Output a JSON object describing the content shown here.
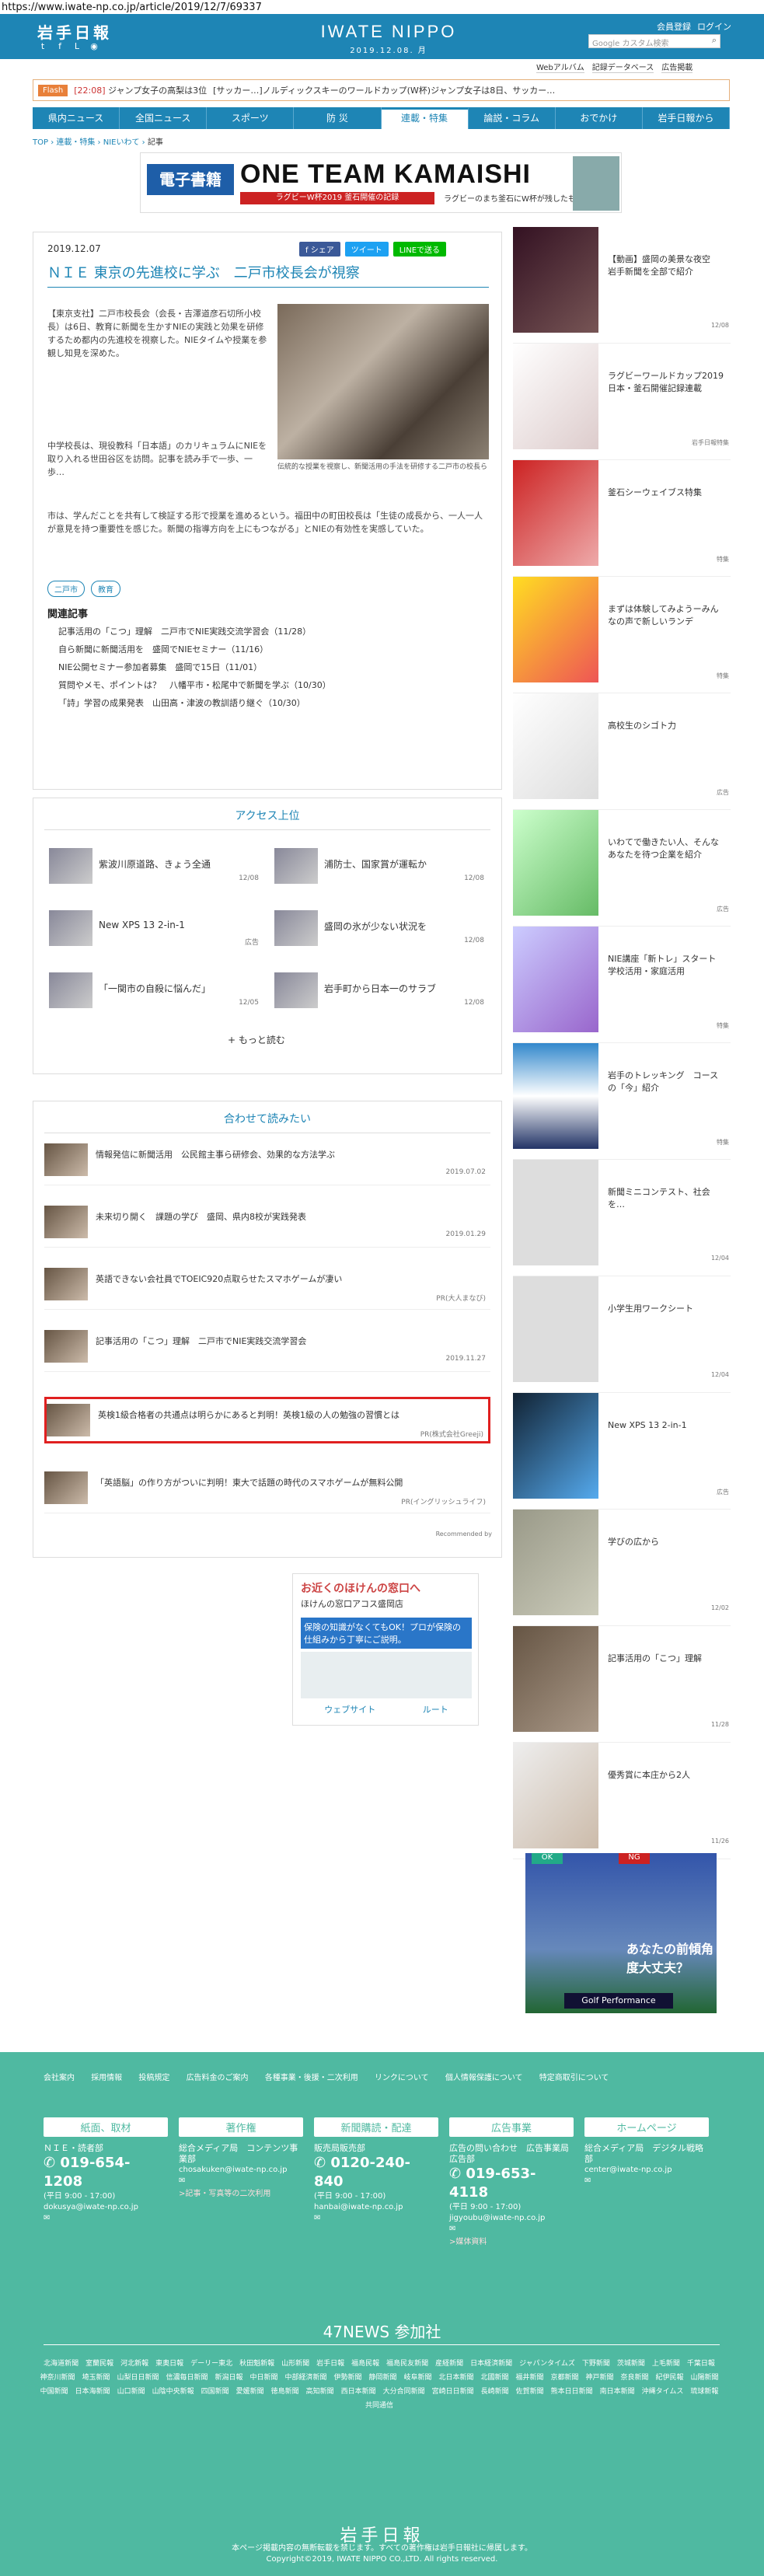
{
  "url": "https://www.iwate-np.co.jp/article/2019/12/7/69337",
  "header": {
    "logo": "岩手日報",
    "site_title": "IWATE NIPPO",
    "site_date": "2019.12.08. 月",
    "links": [
      "会員登録",
      "ログイン"
    ],
    "search_placeholder": "Google カスタム検索",
    "sub_links": [
      "Webアルバム",
      "記録データベース",
      "広告掲載"
    ]
  },
  "flash": {
    "label": "Flash",
    "items": [
      {
        "time": "[22:08]",
        "text": "ジャンプ女子の高梨は3位"
      },
      {
        "time": "",
        "text": "[サッカー…]ノルディックスキーのワールドカップ(W杯)ジャンプ女子は8日、サッカー…"
      }
    ]
  },
  "nav": [
    "県内ニュース",
    "全国ニュース",
    "スポーツ",
    "防 災",
    "連載・特集",
    "論説・コラム",
    "おでかけ",
    "岩手日報から"
  ],
  "breadcrumb": [
    "TOP",
    "連載・特集",
    "NIEいわて"
  ],
  "breadcrumb_current": "記事",
  "banner": {
    "b1": "電子書籍",
    "b2": "ONE TEAM KAMAISHI",
    "b3": "ラグビーW杯2019 釜石開催の記録",
    "b4": "ラグビーのまち釜石にW杯が残したものとは…"
  },
  "article": {
    "date": "2019.12.07",
    "share": [
      "f シェア",
      "ツイート",
      "LINEで送る"
    ],
    "headline": "ＮＩＥ 東京の先進校に学ぶ　二戸市校長会が視察",
    "caption": "伝統的な授業を視察し、新聞活用の手法を研修する二戸市の校長ら",
    "body1": "【東京支社】二戸市校長会（会長・吉澤道彦石切所小校長）は6日、教育に新聞を生かすNIEの実践と効果を研修するため都内の先進校を視察した。NIEタイムや授業を参観し知見を深めた。",
    "body2": "中学校長は、現役教科「日本語」のカリキュラムにNIEを取り入れる世田谷区を訪問。記事を読み手で一歩、一歩…",
    "body3": "市は、学んだことを共有して検証する形で授業を進めるという。福田中の町田校長は「生徒の成長から、一人一人が意見を持つ重要性を感じた。新聞の指導方向を上にもつながる」とNIEの有効性を実感していた。",
    "tags": [
      "二戸市",
      "教育"
    ],
    "related_title": "関連記事",
    "related": [
      "記事活用の「こつ」理解　二戸市でNIE実践交流学習会（11/28）",
      "自ら新聞に新聞活用を　盛岡でNIEセミナー（11/16）",
      "NIE公開セミナー参加者募集　盛岡で15日（11/01）",
      "質問やメモ、ポイントは？　八幡平市・松尾中で新聞を学ぶ（10/30）",
      "「詩」学習の成果発表　山田高・津波の教訓語り継ぐ（10/30）"
    ]
  },
  "ranking": {
    "title": "アクセス上位",
    "items": [
      {
        "text": "紫波川原道路、きょう全通",
        "date": "12/08"
      },
      {
        "text": "浦防士、国家賞が運転か",
        "date": "12/08"
      },
      {
        "text": "New XPS 13 2-in-1",
        "date": "広告"
      },
      {
        "text": "盛岡の氷が少ない状況を",
        "date": "12/08"
      },
      {
        "text": "「一関市の自殺に悩んだ」",
        "date": "12/05"
      },
      {
        "text": "岩手町から日本一のサラブ",
        "date": "12/08"
      }
    ],
    "more": "もっと読む"
  },
  "read_also": {
    "title": "合わせて読みたい",
    "items": [
      {
        "text": "情報発信に新聞活用　公民館主事ら研修会、効果的な方法学ぶ",
        "date": "2019.07.02"
      },
      {
        "text": "未来切り開く　課題の学び　盛岡、県内8校が実践発表",
        "date": "2019.01.29"
      },
      {
        "text": "英語できない会社員でTOEIC920点取らせたスマホゲームが凄い",
        "date": "PR(大人まなび)"
      },
      {
        "text": "記事活用の「こつ」理解　二戸市でNIE実践交流学習会",
        "date": "2019.11.27"
      },
      {
        "text": "英検1級合格者の共通点は明らかにあると判明！英検1級の人の勉強の習慣とは",
        "date": "PR(株式会社Greeji)"
      },
      {
        "text": "「英語脳」の作り方がついに判明！東大で話題の時代のスマホゲームが無料公開",
        "date": "PR(イングリッシュライフ)"
      }
    ],
    "powered": "Recommended by"
  },
  "ad_small": {
    "a1": "お近くのほけんの窓口へ",
    "a2": "ほけんの窓口アコス盛岡店",
    "a3": "保険の知識がなくてもOK！プロが保険の仕組みから丁寧にご説明。",
    "a5": [
      "ウェブサイト",
      "ルート"
    ]
  },
  "sidebar": [
    {
      "text": "【動画】盛岡の美景な夜空　岩手新聞を全部で紹介",
      "date": "12/08"
    },
    {
      "text": "ラグビーワールドカップ2019日本・釜石開催記録連載",
      "date": "岩手日報特集"
    },
    {
      "text": "釜石シーウェイブス特集",
      "date": "特集"
    },
    {
      "text": "まずは体験してみようーみんなの声で新しいランデ",
      "date": "特集"
    },
    {
      "text": "高校生のシゴト力",
      "date": "広告"
    },
    {
      "text": "いわてで働きたい人、そんなあなたを待つ企業を紹介",
      "date": "広告"
    },
    {
      "text": "NIE講座「新トレ」スタート　学校活用・家庭活用",
      "date": "特集"
    },
    {
      "text": "岩手のトレッキング　コースの「今」紹介",
      "date": "特集"
    },
    {
      "text": "新聞ミニコンテスト、社会を…",
      "date": "12/04"
    },
    {
      "text": "小学生用ワークシート",
      "date": "12/04"
    },
    {
      "text": "New XPS 13 2-in-1",
      "date": "広告"
    },
    {
      "text": "学びの広から",
      "date": "12/02"
    },
    {
      "text": "記事活用の「こつ」理解",
      "date": "11/28"
    },
    {
      "text": "優秀賞に本庄から2人",
      "date": "11/26"
    }
  ],
  "side_ad": {
    "ok": "OK",
    "ng": "NG",
    "text": "あなたの前傾角度大丈夫？",
    "brand": "Golf Performance"
  },
  "footer": {
    "links": [
      "会社案内",
      "採用情報",
      "投稿規定",
      "広告料金のご案内",
      "各種事業・後援・二次利用",
      "リンクについて",
      "個人情報保護について",
      "特定商取引について"
    ],
    "columns": [
      {
        "head": "紙面、取材",
        "label": "ＮＩＥ・読者部",
        "phone": "019-654-1208",
        "hours": "(平日 9:00 - 17:00)",
        "mail": "dokusya@iwate-np.co.jp"
      },
      {
        "head": "著作権",
        "label": "総合メディア局　コンテンツ事業部",
        "phone": "",
        "hours": "",
        "mail": "chosakuken@iwate-np.co.jp",
        "extra": ">記事・写真等の二次利用"
      },
      {
        "head": "新聞購読・配達",
        "label": "販売局販売部",
        "phone": "0120-240-840",
        "hours": "(平日 9:00 - 17:00)",
        "mail": "hanbai@iwate-np.co.jp"
      },
      {
        "head": "広告事業",
        "label": "広告の問い合わせ　広告事業局広告部",
        "phone": "019-653-4118",
        "hours": "(平日 9:00 - 17:00)",
        "mail": "jigyoubu@iwate-np.co.jp",
        "extra": ">媒体資料"
      },
      {
        "head": "ホームページ",
        "label": "総合メディア局　デジタル戦略部",
        "phone": "",
        "hours": "",
        "mail": "center@iwate-np.co.jp"
      }
    ],
    "n47": "47NEWS 参加社",
    "papers": "北海道新聞　室蘭民報　河北新報　東奥日報　デーリー東北　秋田魁新報　山形新聞　岩手日報　福島民報　福島民友新聞　産経新聞　日本経済新聞　ジャパンタイムズ　下野新聞　茨城新聞　上毛新聞　千葉日報　神奈川新聞　埼玉新聞　山梨日日新聞　信濃毎日新聞　新潟日報　中日新聞　中部経済新聞　伊勢新聞　静岡新聞　岐阜新聞　北日本新聞　北國新聞　福井新聞　京都新聞　神戸新聞　奈良新聞　紀伊民報　山陽新聞　中国新聞　日本海新聞　山口新聞　山陰中央新報　四国新聞　愛媛新聞　徳島新聞　高知新聞　西日本新聞　大分合同新聞　宮崎日日新聞　長崎新聞　佐賀新聞　熊本日日新聞　南日本新聞　沖縄タイムス　琉球新報　共同通信",
    "logo": "岩手日報",
    "copy1": "本ページ掲載内容の無断転載を禁じます。すべての著作権は岩手日報社に帰属します。",
    "copy2": "Copyright©2019, IWATE NIPPO CO.,LTD. All rights reserved."
  }
}
